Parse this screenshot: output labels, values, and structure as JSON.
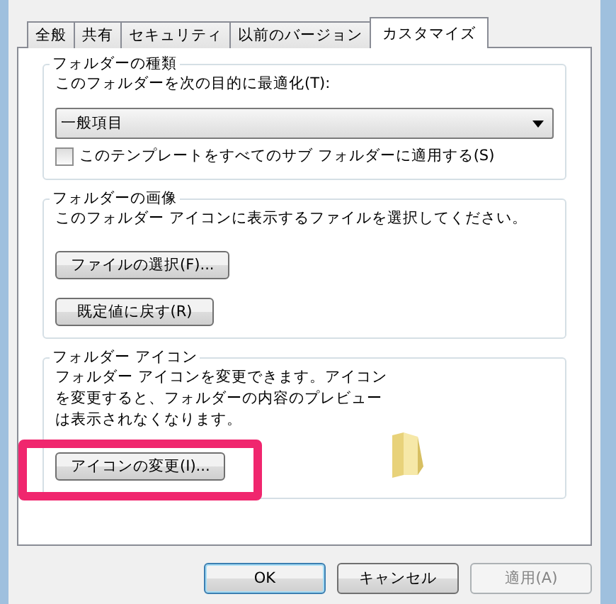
{
  "tabs": [
    {
      "label": "全般",
      "selected": false
    },
    {
      "label": "共有",
      "selected": false
    },
    {
      "label": "セキュリティ",
      "selected": false
    },
    {
      "label": "以前のバージョン",
      "selected": false
    },
    {
      "label": "カスタマイズ",
      "selected": true
    }
  ],
  "groups": [
    {
      "title": "フォルダーの種類",
      "label": "このフォルダーを次の目的に最適化(T):",
      "dropdown": {
        "value": "一般項目"
      },
      "checkbox": {
        "label": "このテンプレートをすべてのサブ フォルダーに適用する(S)",
        "checked": false
      }
    },
    {
      "title": "フォルダーの画像",
      "description": "このフォルダー アイコンに表示するファイルを選択してください。",
      "buttons": [
        "ファイルの選択(F)...",
        "既定値に戻す(R)"
      ]
    },
    {
      "title": "フォルダー アイコン",
      "description": "フォルダー アイコンを変更できます。アイコンを変更すると、フォルダーの内容のプレビューは表示されなくなります。",
      "buttons": [
        "アイコンの変更(I)..."
      ],
      "folder_preview": true
    }
  ],
  "buttons": [
    {
      "label": "OK",
      "disabled": false,
      "default": true
    },
    {
      "label": "キャンセル",
      "disabled": false,
      "default": false
    },
    {
      "label": "適用(A)",
      "disabled": true,
      "default": false
    }
  ]
}
